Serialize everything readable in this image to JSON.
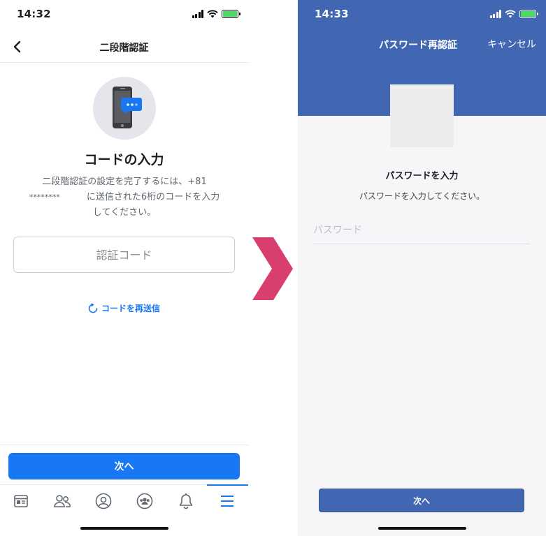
{
  "left_screen": {
    "status_time": "14:32",
    "nav_title": "二段階認証",
    "heading": "コードの入力",
    "description_line1": "二段階認証の設定を完了するには、+81",
    "description_masked": "********",
    "description_line2": "に送信された6桁のコードを入力",
    "description_line3": "してください。",
    "code_placeholder": "認証コード",
    "resend_label": "コードを再送信",
    "next_label": "次へ",
    "tabs": [
      "news-feed",
      "friends",
      "profile",
      "groups",
      "notifications",
      "menu"
    ],
    "active_tab": "menu"
  },
  "right_screen": {
    "status_time": "14:33",
    "nav_title": "パスワード再認証",
    "cancel_label": "キャンセル",
    "heading": "パスワードを入力",
    "description": "パスワードを入力してください。",
    "password_placeholder": "パスワード",
    "next_label": "次へ"
  },
  "colors": {
    "fb_blue": "#1877f2",
    "header_blue": "#4267b2",
    "arrow_pink": "#d83f6e"
  }
}
